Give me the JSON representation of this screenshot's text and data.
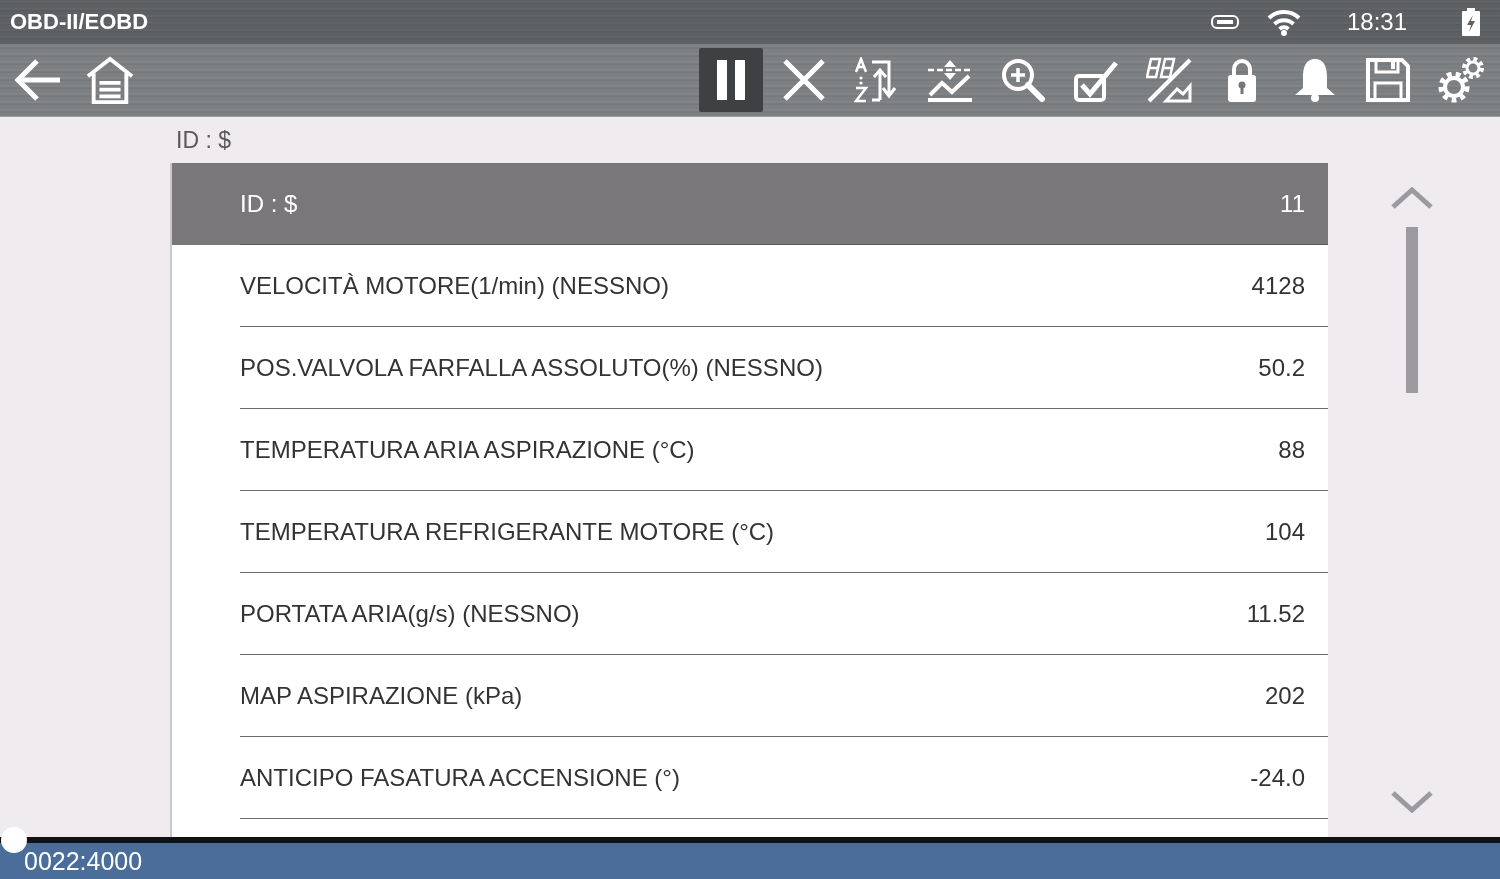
{
  "status_bar": {
    "title": "OBD-II/EOBD",
    "time": "18:31"
  },
  "toolbar": {
    "nav": [
      {
        "kind": "back"
      },
      {
        "kind": "home"
      }
    ],
    "buttons": [
      {
        "kind": "pause",
        "selected": true
      },
      {
        "kind": "clear",
        "selected": false
      },
      {
        "kind": "sort",
        "selected": false
      },
      {
        "kind": "graph",
        "selected": false
      },
      {
        "kind": "zoom",
        "selected": false
      },
      {
        "kind": "select",
        "selected": false
      },
      {
        "kind": "display",
        "selected": false
      },
      {
        "kind": "lock",
        "selected": false
      },
      {
        "kind": "alert",
        "selected": false
      },
      {
        "kind": "save",
        "selected": false
      },
      {
        "kind": "settings",
        "selected": false
      }
    ]
  },
  "list": {
    "label": "ID : $",
    "rows": [
      {
        "label": "ID : $",
        "value": "11",
        "selected": true
      },
      {
        "label": "VELOCITÀ MOTORE(1/min) (NESSNO)",
        "value": "4128",
        "selected": false
      },
      {
        "label": "POS.VALVOLA FARFALLA ASSOLUTO(%) (NESSNO)",
        "value": "50.2",
        "selected": false
      },
      {
        "label": "TEMPERATURA ARIA ASPIRAZIONE (°C)",
        "value": "88",
        "selected": false
      },
      {
        "label": "TEMPERATURA REFRIGERANTE MOTORE (°C)",
        "value": "104",
        "selected": false
      },
      {
        "label": "PORTATA ARIA(g/s) (NESSNO)",
        "value": "11.52",
        "selected": false
      },
      {
        "label": "MAP ASPIRAZIONE (kPa)",
        "value": "202",
        "selected": false
      },
      {
        "label": "ANTICIPO FASATURA ACCENSIONE (°)",
        "value": "-24.0",
        "selected": false
      }
    ]
  },
  "footer": {
    "counter": "0022:4000",
    "playback": {
      "level": 0
    }
  }
}
